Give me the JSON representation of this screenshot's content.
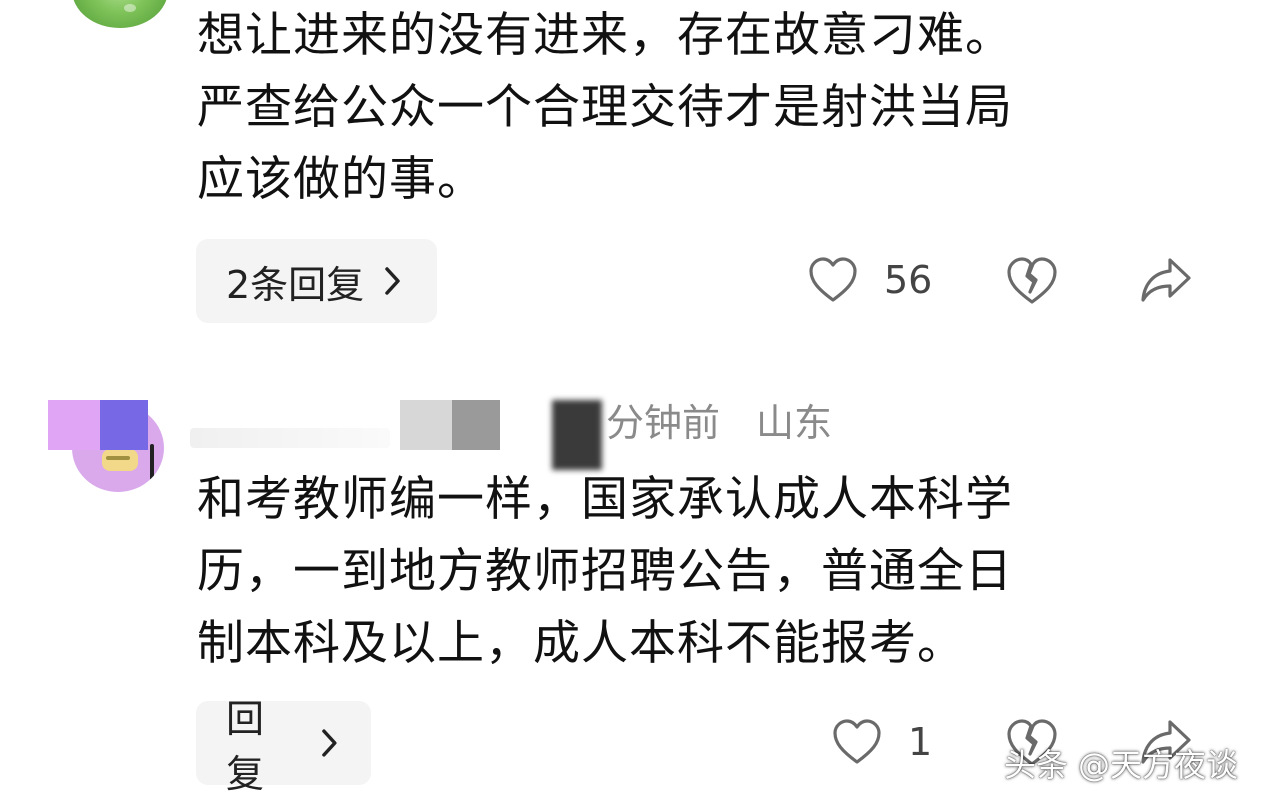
{
  "comments": [
    {
      "text_lines": [
        "想让进来的没有进来，存在故意刁难。",
        "严查给公众一个合理交待才是射洪当局",
        "应该做的事。"
      ],
      "reply_label": "2条回复",
      "likes": "56",
      "icons": [
        "heart-icon",
        "broken-heart-icon",
        "share-icon"
      ]
    },
    {
      "time": "分钟前",
      "location": "山东",
      "text_lines": [
        "和考教师编一样，国家承认成人本科学",
        "历，一到地方教师招聘公告，普通全日",
        "制本科及以上，成人本科不能报考。"
      ],
      "reply_label": "回复",
      "likes": "1",
      "icons": [
        "heart-icon",
        "broken-heart-icon",
        "share-icon"
      ]
    }
  ],
  "watermark": "头条 @天方夜谈"
}
